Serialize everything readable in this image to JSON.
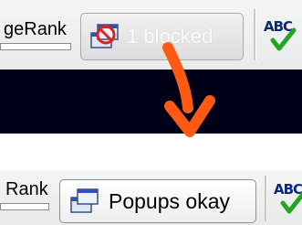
{
  "top_toolbar": {
    "pagerank_label": "geRank",
    "popup_button_label": "1 blocked",
    "spell_icon_text": "ABC"
  },
  "bottom_toolbar": {
    "pagerank_label": "Rank",
    "popup_button_label": "Popups okay",
    "spell_icon_text": "ABC"
  },
  "arrow_color": "#ff5a14",
  "banner_color": "#000018",
  "icons": {
    "blocked": "popup-blocked-icon",
    "allowed": "popup-windows-icon",
    "spell": "spellcheck-icon"
  }
}
